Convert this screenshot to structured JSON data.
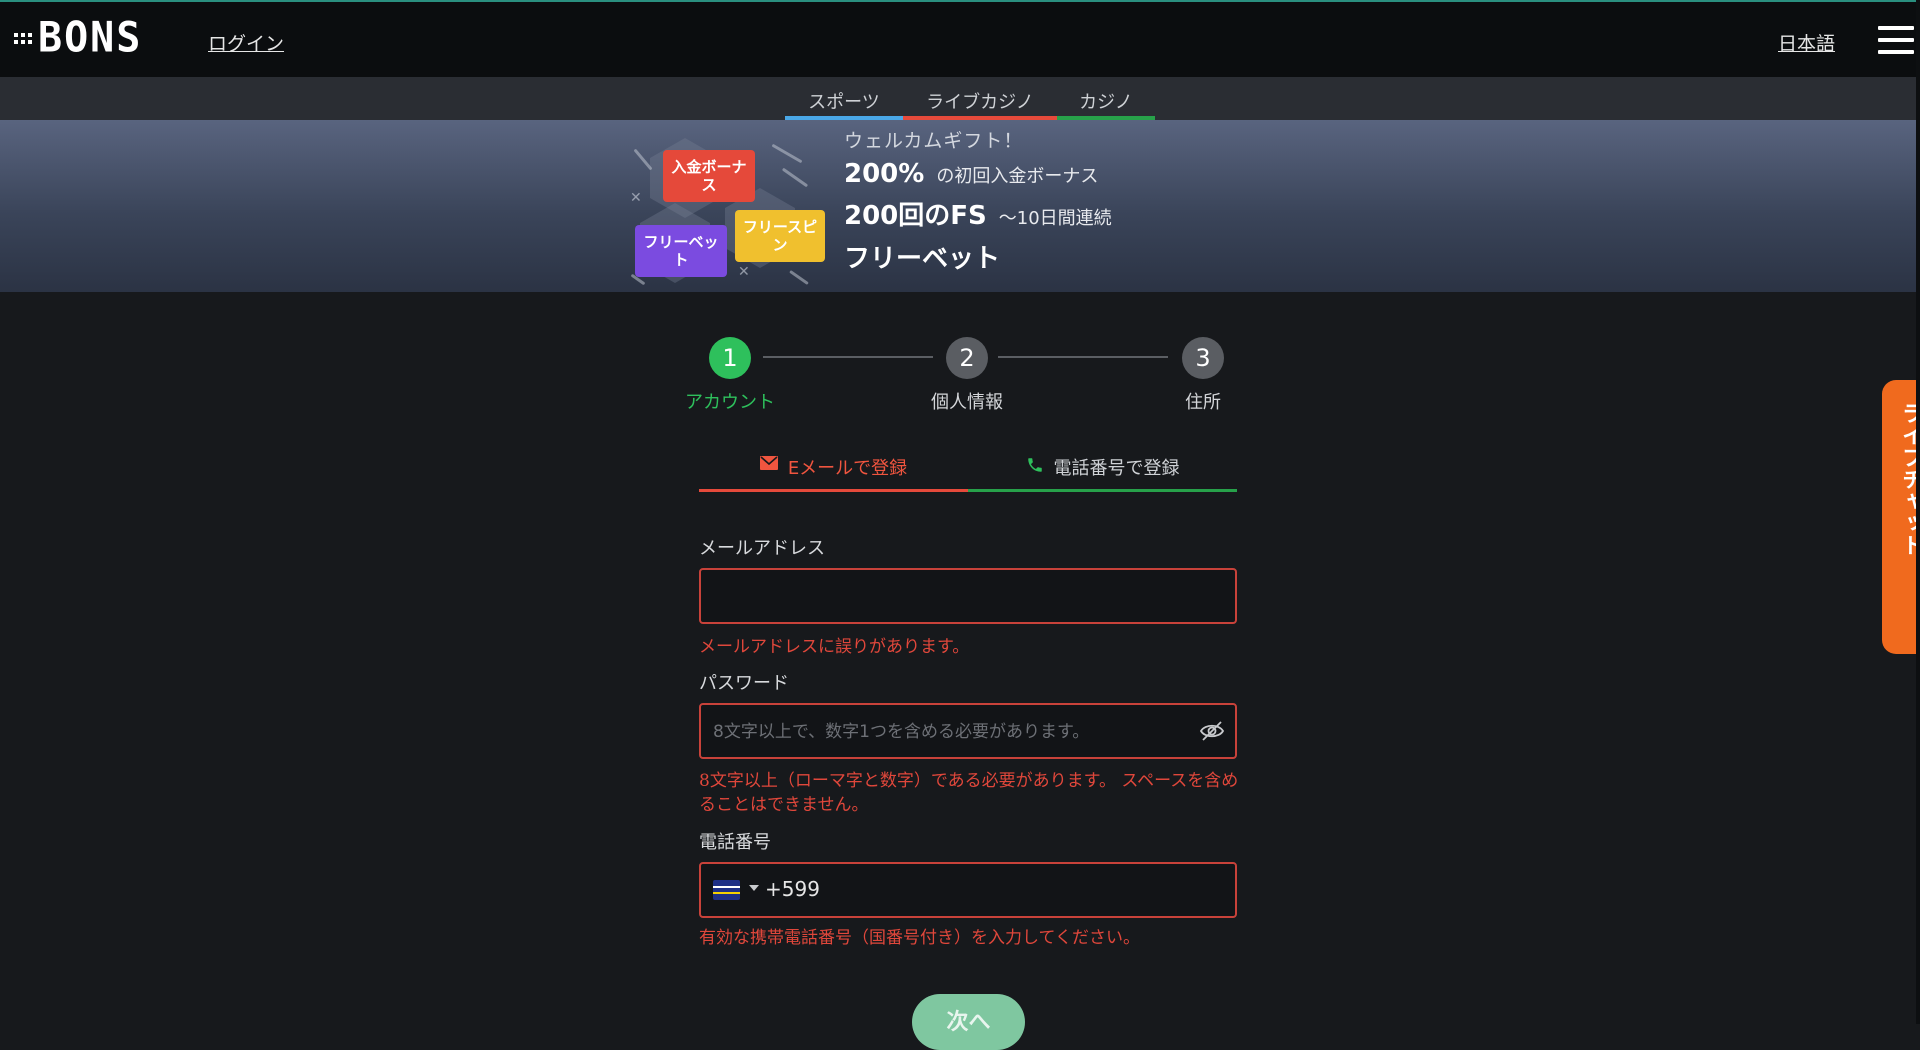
{
  "header": {
    "logo_text": "BONS",
    "login_label": "ログイン",
    "language_label": "日本語"
  },
  "nav": {
    "tabs": [
      {
        "label": "スポーツ",
        "color": "#4aa8e8"
      },
      {
        "label": "ライブカジノ",
        "color": "#e64a3b"
      },
      {
        "label": "カジノ",
        "color": "#27a14a"
      }
    ]
  },
  "banner": {
    "badges": [
      "入金ボーナス",
      "フリーベット",
      "フリースピン"
    ],
    "welcome": "ウェルカムギフト！",
    "line1_big": "200%",
    "line1_small": "の初回入金ボーナス",
    "line2_big": "200回のFS",
    "line2_small": "〜10日間連続",
    "line3_big": "フリーベット"
  },
  "steps": [
    {
      "number": "1",
      "label": "アカウント",
      "active": true
    },
    {
      "number": "2",
      "label": "個人情報",
      "active": false
    },
    {
      "number": "3",
      "label": "住所",
      "active": false
    }
  ],
  "registration_tabs": {
    "email": "Eメールで登録",
    "phone": "電話番号で登録"
  },
  "form": {
    "email": {
      "label": "メールアドレス",
      "value": "",
      "placeholder": "",
      "error": "メールアドレスに誤りがあります。"
    },
    "password": {
      "label": "パスワード",
      "value": "",
      "placeholder": "8文字以上で、数字1つを含める必要があります。",
      "error": "8文字以上（ローマ字と数字）である必要があります。 スペースを含めることはできません。"
    },
    "phone": {
      "label": "電話番号",
      "country_flag": "curacao-flag-icon",
      "prefix": "+599",
      "error": "有効な携帯電話番号（国番号付き）を入力してください。"
    },
    "next_button": "次へ"
  },
  "side_tab": {
    "label": "ライブチャット",
    "color": "#f06a1e"
  },
  "colors": {
    "accent_green": "#2ec05c",
    "error_red": "#e0473b",
    "background": "#17191c"
  }
}
